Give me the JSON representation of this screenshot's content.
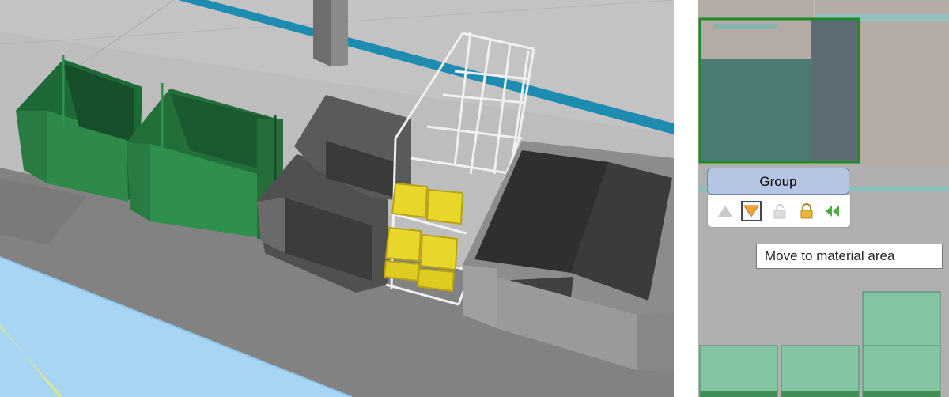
{
  "group_panel": {
    "title": "Group",
    "toolbar": [
      {
        "icon": "triangle-up-icon",
        "enabled": false
      },
      {
        "icon": "triangle-down-icon",
        "enabled": true,
        "selected": true
      },
      {
        "icon": "unlock-icon",
        "enabled": false
      },
      {
        "icon": "lock-icon",
        "enabled": true
      },
      {
        "icon": "double-chevron-left-icon",
        "enabled": true
      }
    ]
  },
  "tooltip": {
    "text": "Move to material area"
  },
  "colors": {
    "panel_header": "#b4c6e3",
    "selection_green": "#1f8a2a",
    "orange_arrow": "#f0a13a",
    "lock_gold": "#e8b53a",
    "chevron_green": "#4cae3f",
    "bin_green": "#2e7d45",
    "crate_yellow": "#e6d21a"
  }
}
